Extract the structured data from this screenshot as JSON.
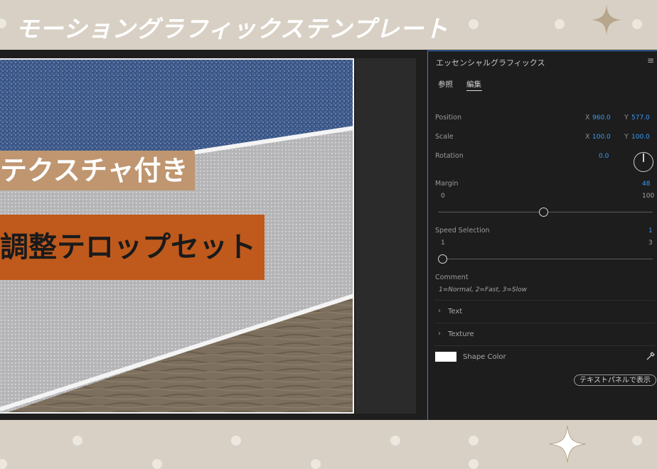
{
  "banner": {
    "title": "モーショングラフィックステンプレート"
  },
  "preview": {
    "caption_top": "テクスチャ付き",
    "caption_bottom": "調整テロップセット"
  },
  "panel": {
    "title": "エッセンシャルグラフィックス",
    "menu_icon": "hamburger-menu-icon",
    "tabs": [
      {
        "label": "参照",
        "active": false
      },
      {
        "label": "編集",
        "active": true
      }
    ],
    "position": {
      "label": "Position",
      "x_label": "X",
      "x": "960.0",
      "y_label": "Y",
      "y": "577.0"
    },
    "scale": {
      "label": "Scale",
      "x_label": "X",
      "x": "100.0",
      "y_label": "Y",
      "y": "100.0"
    },
    "rotation": {
      "label": "Rotation",
      "value": "0.0"
    },
    "margin": {
      "label": "Margin",
      "value": "48",
      "min": "0",
      "max": "100"
    },
    "speed": {
      "label": "Speed Selection",
      "value": "1",
      "min": "1",
      "max": "3"
    },
    "comment": {
      "label": "Comment",
      "text": "1=Normal, 2=Fast, 3=Slow"
    },
    "sections": [
      {
        "label": "Text"
      },
      {
        "label": "Texture"
      }
    ],
    "shape_color": {
      "label": "Shape Color",
      "color": "#ffffff"
    },
    "show_in_text_panel_button": "テキストパネルで表示"
  },
  "colors": {
    "accent_blue": "#3a9bf5",
    "background": "#d8d0c4",
    "caption_top_bg": "#bf9670",
    "caption_bottom_bg": "#bf5a1c"
  }
}
